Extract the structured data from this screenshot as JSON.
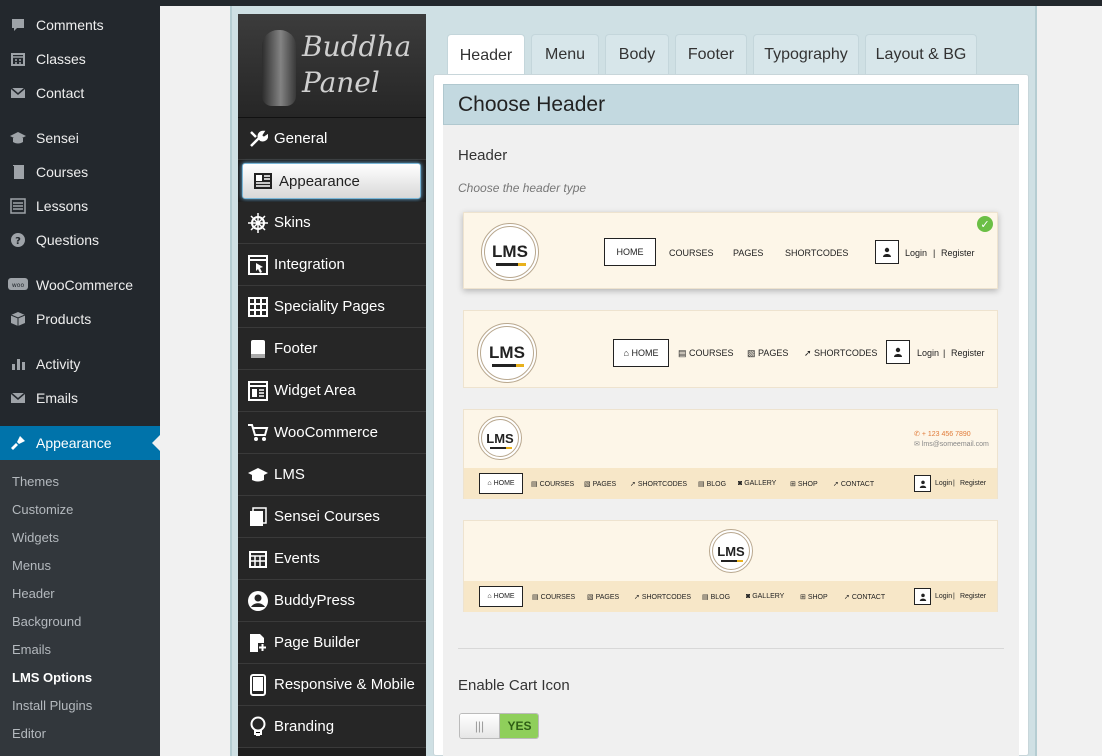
{
  "wp_menu": [
    {
      "label": "Comments",
      "icon": "comment-icon"
    },
    {
      "label": "Classes",
      "icon": "calendar-icon"
    },
    {
      "label": "Contact",
      "icon": "mail-icon"
    },
    {
      "label": "Sensei",
      "icon": "graduation-cap-icon"
    },
    {
      "label": "Courses",
      "icon": "book-icon"
    },
    {
      "label": "Lessons",
      "icon": "list-icon"
    },
    {
      "label": "Questions",
      "icon": "question-icon"
    },
    {
      "label": "WooCommerce",
      "icon": "woo-icon"
    },
    {
      "label": "Products",
      "icon": "box-icon"
    },
    {
      "label": "Activity",
      "icon": "activity-icon"
    },
    {
      "label": "Emails",
      "icon": "mail-icon"
    },
    {
      "label": "Appearance",
      "icon": "brush-icon",
      "active": true
    }
  ],
  "wp_submenu": [
    "Themes",
    "Customize",
    "Widgets",
    "Menus",
    "Header",
    "Background",
    "Emails",
    "LMS Options",
    "Install Plugins",
    "Editor"
  ],
  "wp_submenu_current": "LMS Options",
  "logo": {
    "line1": "Buddha",
    "line2": "Panel"
  },
  "panel_menu": [
    {
      "label": "General",
      "icon": "wrench-icon"
    },
    {
      "label": "Appearance",
      "icon": "newspaper-icon",
      "selected": true
    },
    {
      "label": "Skins",
      "icon": "ship-wheel-icon"
    },
    {
      "label": "Integration",
      "icon": "window-cursor-icon"
    },
    {
      "label": "Speciality Pages",
      "icon": "grid-icon"
    },
    {
      "label": "Footer",
      "icon": "footer-icon"
    },
    {
      "label": "Widget Area",
      "icon": "widget-icon"
    },
    {
      "label": "WooCommerce",
      "icon": "cart-icon"
    },
    {
      "label": "LMS",
      "icon": "graduation-cap-icon"
    },
    {
      "label": "Sensei Courses",
      "icon": "stack-icon"
    },
    {
      "label": "Events",
      "icon": "calendar-icon"
    },
    {
      "label": "BuddyPress",
      "icon": "user-circle-icon"
    },
    {
      "label": "Page Builder",
      "icon": "page-builder-icon"
    },
    {
      "label": "Responsive & Mobile",
      "icon": "tablet-icon"
    },
    {
      "label": "Branding",
      "icon": "bulb-icon"
    }
  ],
  "tabs": [
    "Header",
    "Menu",
    "Body",
    "Footer",
    "Typography",
    "Layout & BG"
  ],
  "active_tab": "Header",
  "section_title": "Choose Header",
  "header_option": {
    "title": "Header",
    "description": "Choose the header type",
    "logo_text": "LMS",
    "card1_nav": [
      "HOME",
      "COURSES",
      "PAGES",
      "SHORTCODES"
    ],
    "card2_nav": [
      "HOME",
      "COURSES",
      "PAGES",
      "SHORTCODES"
    ],
    "card34_nav": [
      "HOME",
      "COURSES",
      "PAGES",
      "SHORTCODES",
      "BLOG",
      "GALLERY",
      "SHOP",
      "CONTACT"
    ],
    "login": "Login",
    "separator": "|",
    "register": "Register",
    "phone": "+ 123 456 7890",
    "email": "lms@someemail.com"
  },
  "cart_option": {
    "title": "Enable Cart Icon",
    "toggle_off_glyph": "|||",
    "toggle_on_label": "YES"
  },
  "colors": {
    "wp_active": "#0073aa",
    "toggle_yes": "#8fcf5b",
    "section_head": "#c3d9e0"
  }
}
